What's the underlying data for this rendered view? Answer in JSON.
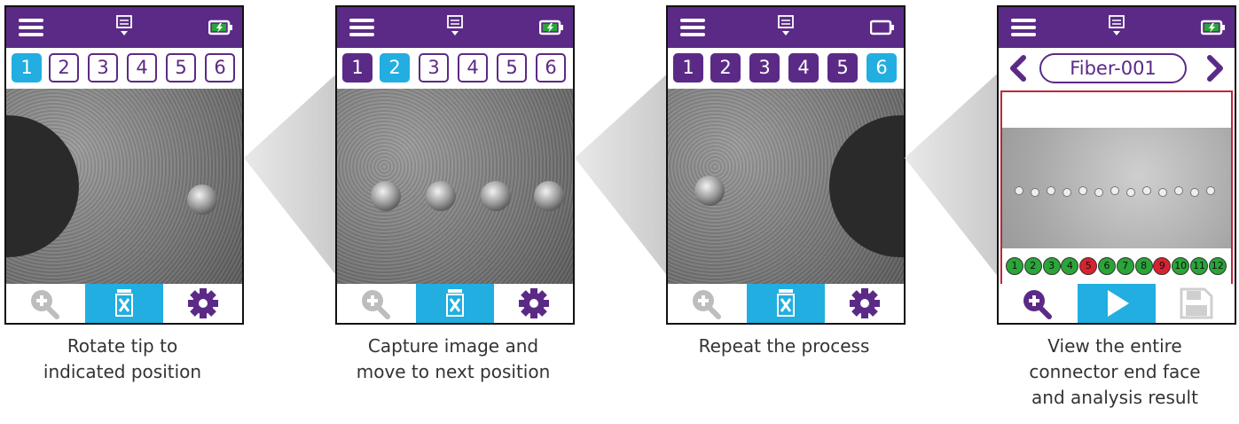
{
  "colors": {
    "purple": "#5b2a86",
    "blue": "#22aee0",
    "pass": "#2aa538",
    "fail": "#d8222f"
  },
  "screens": [
    {
      "tabs": [
        "1",
        "2",
        "3",
        "4",
        "5",
        "6"
      ],
      "active_tab": 0,
      "caption": [
        "Rotate tip to",
        "indicated position"
      ]
    },
    {
      "tabs": [
        "1",
        "2",
        "3",
        "4",
        "5",
        "6"
      ],
      "active_tab": 1,
      "caption": [
        "Capture image and",
        "move to next position"
      ]
    },
    {
      "tabs": [
        "1",
        "2",
        "3",
        "4",
        "5",
        "6"
      ],
      "active_tab": 5,
      "caption": [
        "Repeat the process"
      ]
    },
    {
      "fiber_name": "Fiber-001",
      "caption": [
        "View the entire",
        "connector end face",
        "and analysis result"
      ],
      "fiber_results": [
        {
          "label": "1",
          "status": "pass"
        },
        {
          "label": "2",
          "status": "pass"
        },
        {
          "label": "3",
          "status": "pass"
        },
        {
          "label": "4",
          "status": "pass"
        },
        {
          "label": "5",
          "status": "fail"
        },
        {
          "label": "6",
          "status": "pass"
        },
        {
          "label": "7",
          "status": "pass"
        },
        {
          "label": "8",
          "status": "pass"
        },
        {
          "label": "9",
          "status": "fail"
        },
        {
          "label": "10",
          "status": "pass"
        },
        {
          "label": "11",
          "status": "pass"
        },
        {
          "label": "12",
          "status": "pass"
        }
      ]
    }
  ],
  "icons": {
    "menu": "hamburger-icon",
    "mid": "remote-display-icon",
    "battery": "battery-icon",
    "zoom": "zoom-in-icon",
    "delete": "delete-icon",
    "settings": "gear-icon",
    "play": "play-icon",
    "save": "save-icon",
    "prev": "chevron-left-icon",
    "next": "chevron-right-icon"
  }
}
